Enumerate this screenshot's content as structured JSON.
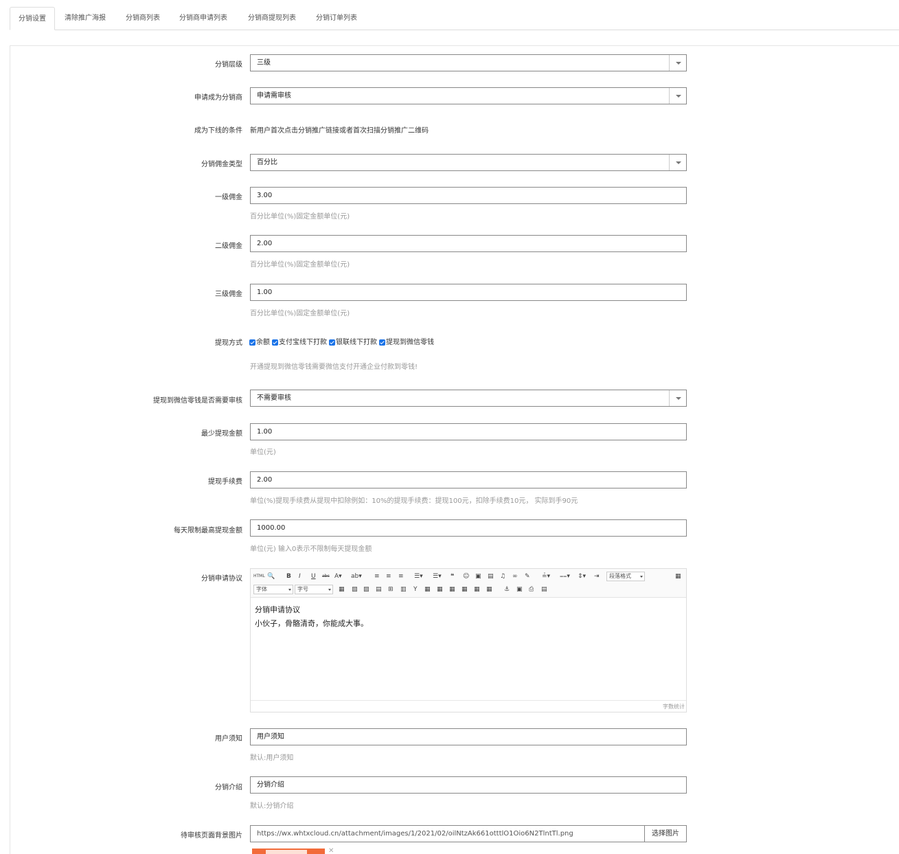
{
  "tabs": [
    "分销设置",
    "清除推广海报",
    "分销商列表",
    "分销商申请列表",
    "分销商提现列表",
    "分销订单列表"
  ],
  "fields": {
    "level": {
      "label": "分销层级",
      "value": "三级"
    },
    "apply": {
      "label": "申请成为分销商",
      "value": "申请需审核"
    },
    "condition": {
      "label": "成为下线的条件",
      "value": "新用户首次点击分销推广链接或者首次扫描分销推广二维码"
    },
    "commission_type": {
      "label": "分销佣金类型",
      "value": "百分比"
    },
    "c1": {
      "label": "一级佣金",
      "value": "3.00",
      "help": "百分比单位(%)固定金额单位(元)"
    },
    "c2": {
      "label": "二级佣金",
      "value": "2.00",
      "help": "百分比单位(%)固定金额单位(元)"
    },
    "c3": {
      "label": "三级佣金",
      "value": "1.00",
      "help": "百分比单位(%)固定金额单位(元)"
    },
    "withdraw_method": {
      "label": "提现方式",
      "options": [
        "余额",
        "支付宝线下打款",
        "银联线下打款",
        "提现到微信零钱"
      ],
      "help": "开通提现到微信零钱需要微信支付开通企业付款到零钱!"
    },
    "wechat_audit": {
      "label": "提现到微信零钱是否需要审核",
      "value": "不需要审核"
    },
    "min_withdraw": {
      "label": "最少提现金额",
      "value": "1.00",
      "help": "单位(元)"
    },
    "fee": {
      "label": "提现手续费",
      "value": "2.00",
      "help": "单位(%)提现手续费从提现中扣除例如：10%的提现手续费：提现100元，扣除手续费10元， 实际到手90元"
    },
    "daily_limit": {
      "label": "每天限制最高提现金额",
      "value": "1000.00",
      "help": "单位(元) 输入0表示不限制每天提现金额"
    },
    "agreement": {
      "label": "分销申请协议",
      "paragraph_format": "段落格式",
      "font": "字体",
      "font_size": "字号",
      "lines": [
        "分销申请协议",
        "小伙子，骨骼清奇，你能成大事。"
      ],
      "word_count": "字数统计"
    },
    "notice": {
      "label": "用户须知",
      "value": "用户须知",
      "help": "默认:用户须知"
    },
    "intro": {
      "label": "分销介绍",
      "value": "分销介绍",
      "help": "默认:分销介绍"
    },
    "bg_image": {
      "label": "待审核页面背景图片",
      "value": "https://wx.whtxcloud.cn/attachment/images/1/2021/02/oilNtzAk661otttlO1Oio6N2TlntTl.png",
      "button": "选择图片"
    }
  }
}
